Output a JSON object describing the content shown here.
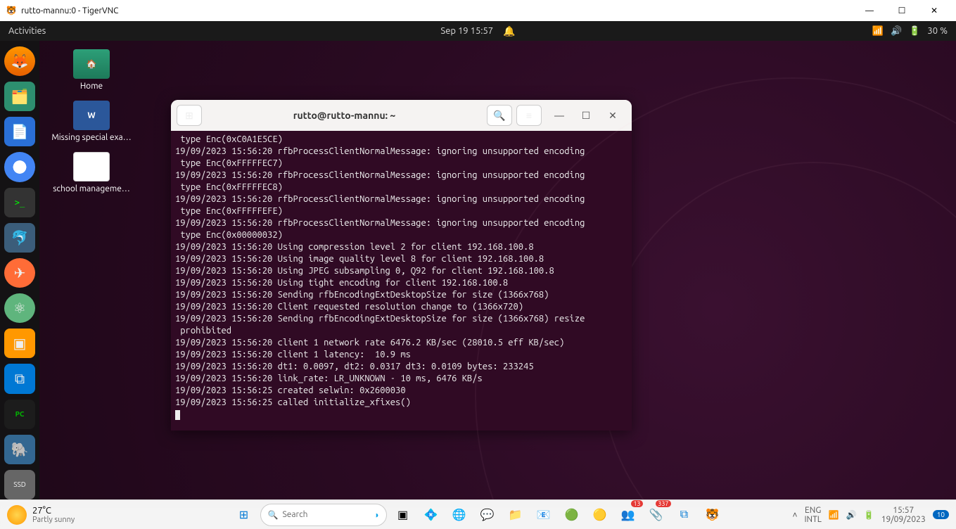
{
  "win_titlebar": {
    "title": "rutto-mannu:0 - TigerVNC"
  },
  "ubuntu_topbar": {
    "activities": "Activities",
    "datetime": "Sep 19  15:57",
    "battery": "30 %"
  },
  "desktop": {
    "home": "Home",
    "missing": "Missing special exa…",
    "school": "school manageme…"
  },
  "terminal": {
    "title": "rutto@rutto-mannu: ~",
    "lines": [
      " type Enc(0xC0A1E5CE)",
      "19/09/2023 15:56:20 rfbProcessClientNormalMessage: ignoring unsupported encoding",
      " type Enc(0xFFFFFEC7)",
      "19/09/2023 15:56:20 rfbProcessClientNormalMessage: ignoring unsupported encoding",
      " type Enc(0xFFFFFEC8)",
      "19/09/2023 15:56:20 rfbProcessClientNormalMessage: ignoring unsupported encoding",
      " type Enc(0xFFFFFEFE)",
      "19/09/2023 15:56:20 rfbProcessClientNormalMessage: ignoring unsupported encoding",
      " type Enc(0x00000032)",
      "19/09/2023 15:56:20 Using compression level 2 for client 192.168.100.8",
      "19/09/2023 15:56:20 Using image quality level 8 for client 192.168.100.8",
      "19/09/2023 15:56:20 Using JPEG subsampling 0, Q92 for client 192.168.100.8",
      "19/09/2023 15:56:20 Using tight encoding for client 192.168.100.8",
      "19/09/2023 15:56:20 Sending rfbEncodingExtDesktopSize for size (1366x768)",
      "19/09/2023 15:56:20 Client requested resolution change to (1366x720)",
      "19/09/2023 15:56:20 Sending rfbEncodingExtDesktopSize for size (1366x768) resize",
      " prohibited",
      "19/09/2023 15:56:20 client 1 network rate 6476.2 KB/sec (28010.5 eff KB/sec)",
      "19/09/2023 15:56:20 client 1 latency:  10.9 ms",
      "19/09/2023 15:56:20 dt1: 0.0097, dt2: 0.0317 dt3: 0.0109 bytes: 233245",
      "19/09/2023 15:56:20 link_rate: LR_UNKNOWN - 10 ms, 6476 KB/s",
      "19/09/2023 15:56:25 created selwin: 0x2600030",
      "19/09/2023 15:56:25 called initialize_xfixes()"
    ]
  },
  "taskbar": {
    "temp": "27°C",
    "cond": "Partly sunny",
    "search_placeholder": "Search",
    "lang1": "ENG",
    "lang2": "INTL",
    "time": "15:57",
    "date": "19/09/2023",
    "notif_count": "10",
    "badges": {
      "teams": "13",
      "office": "337"
    }
  }
}
